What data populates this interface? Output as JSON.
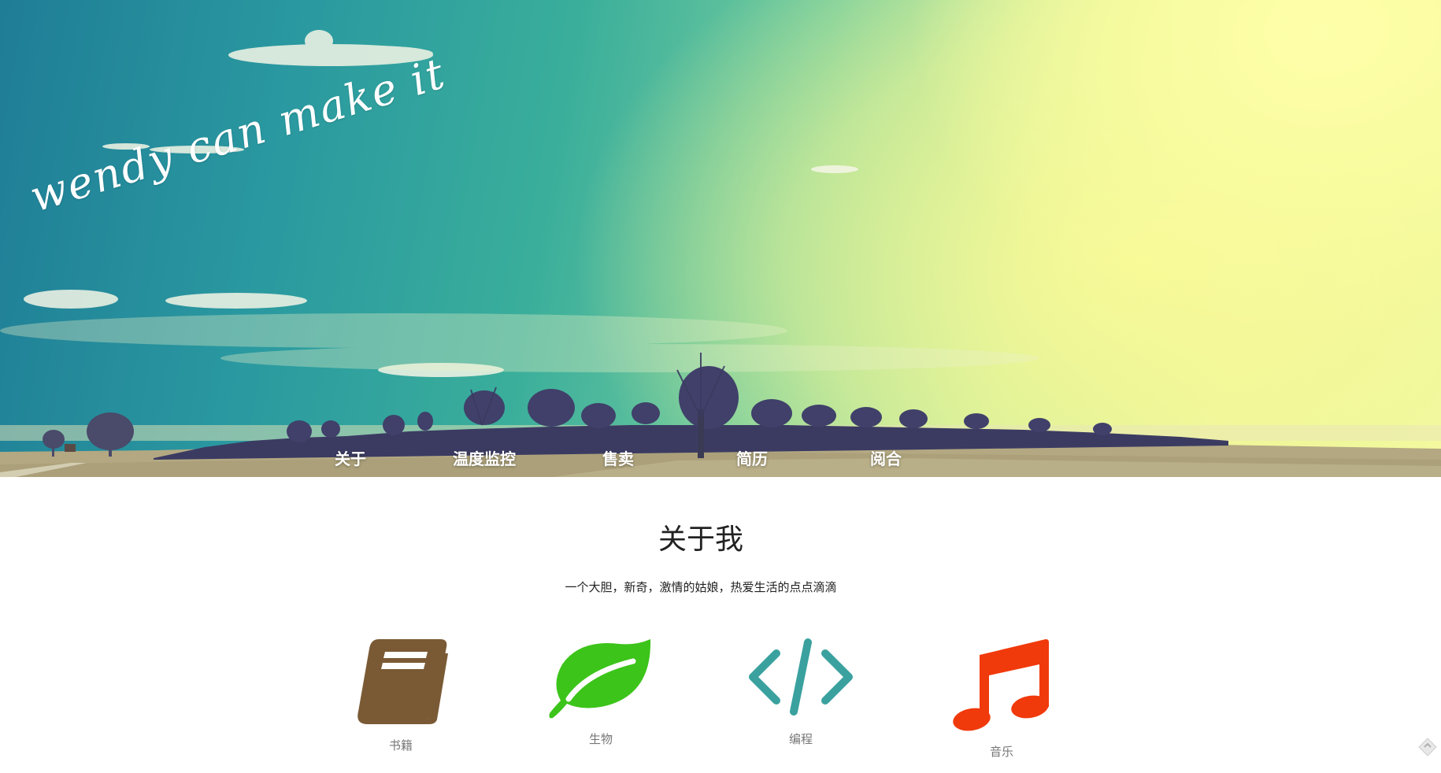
{
  "hero": {
    "tagline": "wendy can make it"
  },
  "nav": {
    "items": [
      {
        "label": "关于"
      },
      {
        "label": "温度监控"
      },
      {
        "label": "售卖"
      },
      {
        "label": "简历"
      },
      {
        "label": "阅合"
      }
    ]
  },
  "about": {
    "title": "关于我",
    "subtitle": "一个大胆，新奇，激情的姑娘，热爱生活的点点滴滴"
  },
  "interests": [
    {
      "label": "书籍",
      "icon": "book-icon",
      "color": "#7a5a35"
    },
    {
      "label": "生物",
      "icon": "leaf-icon",
      "color": "#3cc41a"
    },
    {
      "label": "编程",
      "icon": "code-icon",
      "color": "#3aa19f"
    },
    {
      "label": "音乐",
      "icon": "music-note-icon",
      "color": "#f03a0c"
    }
  ],
  "colors": {
    "sky_teal": "#2a99a0",
    "sky_yellow": "#fbfca6",
    "field": "#b3a882"
  }
}
